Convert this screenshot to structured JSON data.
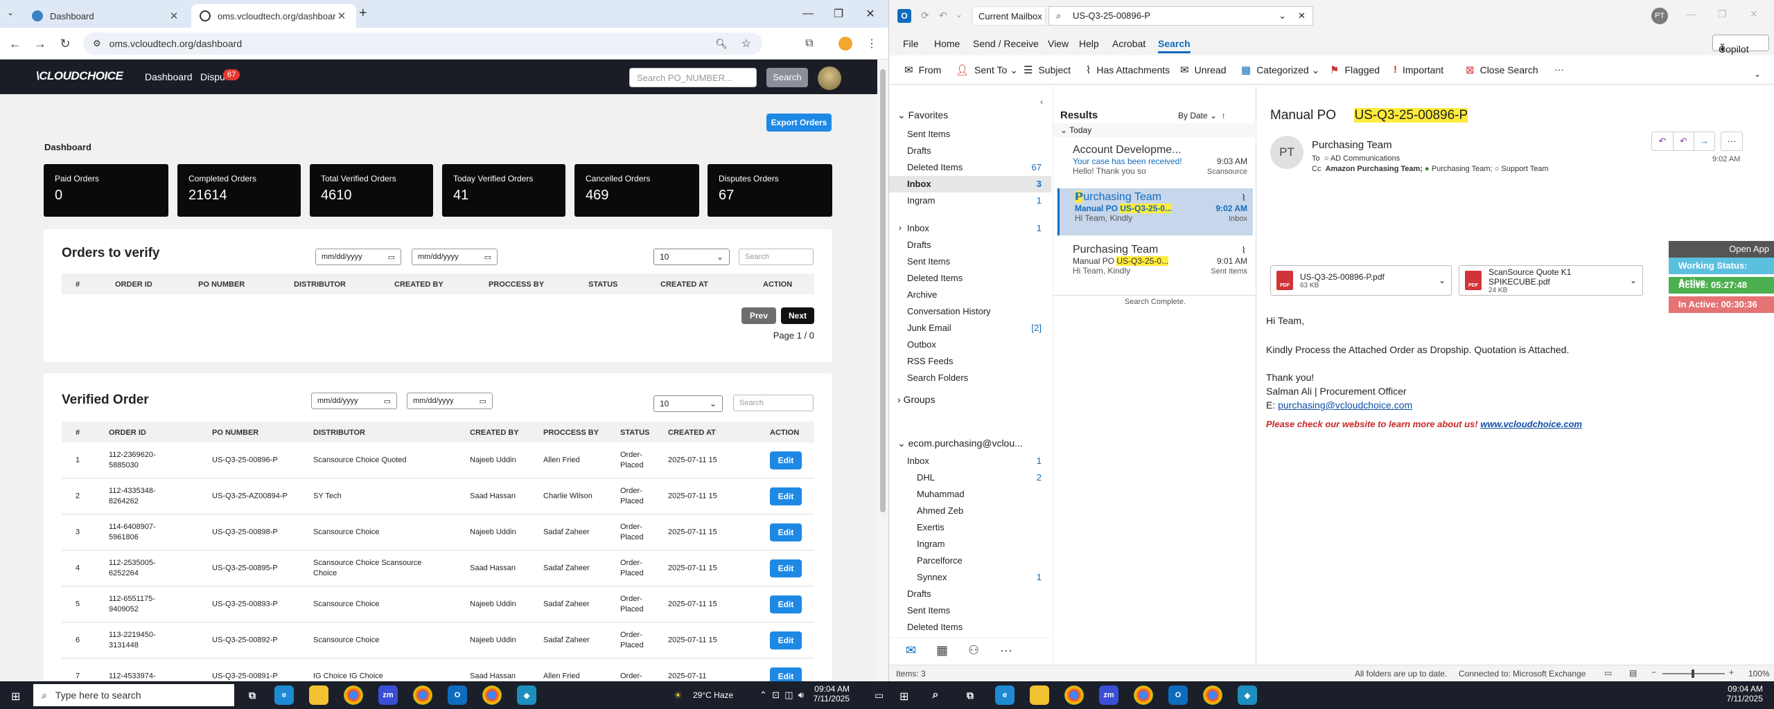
{
  "browser": {
    "tabs": [
      {
        "title": "Dashboard"
      },
      {
        "title": "oms.vcloudtech.org/dashboard"
      }
    ],
    "url": "oms.vcloudtech.org/dashboard"
  },
  "site": {
    "logo": "CLOUDCHOICE",
    "nav": {
      "dashboard": "Dashboard",
      "disputes": "Dispu",
      "disputes_badge": "67"
    },
    "search_placeholder": "Search PO_NUMBER...",
    "search_button": "Search",
    "export_button": "Export Orders",
    "dashboard_title": "Dashboard",
    "cards": [
      {
        "label": "Paid Orders",
        "value": "0"
      },
      {
        "label": "Completed Orders",
        "value": "21614"
      },
      {
        "label": "Total Verified Orders",
        "value": "4610"
      },
      {
        "label": "Today Verified Orders",
        "value": "41"
      },
      {
        "label": "Cancelled Orders",
        "value": "469"
      },
      {
        "label": "Disputes Orders",
        "value": "67"
      }
    ],
    "date_placeholder": "mm/dd/yyyy",
    "page_size": "10",
    "table_search_placeholder": "Search",
    "verify": {
      "title": "Orders to verify",
      "headers": [
        "#",
        "ORDER ID",
        "PO NUMBER",
        "DISTRIBUTOR",
        "CREATED BY",
        "PROCCESS BY",
        "STATUS",
        "CREATED AT",
        "ACTION"
      ],
      "prev": "Prev",
      "next": "Next",
      "page_info": "Page 1 / 0"
    },
    "verified": {
      "title": "Verified Order",
      "headers": [
        "#",
        "ORDER ID",
        "PO NUMBER",
        "DISTRIBUTOR",
        "CREATED BY",
        "PROCCESS BY",
        "STATUS",
        "CREATED AT",
        "ACTION"
      ],
      "edit_label": "Edit",
      "rows": [
        {
          "n": "1",
          "order_id": "112-2369620-5885030",
          "po": "US-Q3-25-00896-P",
          "distributor": "Scansource Choice Quoted",
          "created_by": "Najeeb Uddin",
          "process_by": "Allen Fried",
          "status": "Order-Placed",
          "created_at": "2025-07-11 15"
        },
        {
          "n": "2",
          "order_id": "112-4335348-8264262",
          "po": "US-Q3-25-AZ00894-P",
          "distributor": "SY Tech",
          "created_by": "Saad Hassan",
          "process_by": "Charlie Wilson",
          "status": "Order-Placed",
          "created_at": "2025-07-11 15"
        },
        {
          "n": "3",
          "order_id": "114-6408907-5961806",
          "po": "US-Q3-25-00898-P",
          "distributor": "Scansource Choice",
          "created_by": "Najeeb Uddin",
          "process_by": "Sadaf Zaheer",
          "status": "Order-Placed",
          "created_at": "2025-07-11 15"
        },
        {
          "n": "4",
          "order_id": "112-2535005-6252264",
          "po": "US-Q3-25-00895-P",
          "distributor": "Scansource Choice Scansource Choice",
          "created_by": "Saad Hassan",
          "process_by": "Sadaf Zaheer",
          "status": "Order-Placed",
          "created_at": "2025-07-11 15"
        },
        {
          "n": "5",
          "order_id": "112-6551175-9409052",
          "po": "US-Q3-25-00893-P",
          "distributor": "Scansource Choice",
          "created_by": "Najeeb Uddin",
          "process_by": "Sadaf Zaheer",
          "status": "Order-Placed",
          "created_at": "2025-07-11 15"
        },
        {
          "n": "6",
          "order_id": "113-2219450-3131448",
          "po": "US-Q3-25-00892-P",
          "distributor": "Scansource Choice",
          "created_by": "Najeeb Uddin",
          "process_by": "Sadaf Zaheer",
          "status": "Order-Placed",
          "created_at": "2025-07-11 15"
        },
        {
          "n": "7",
          "order_id": "112-4533974-",
          "po": "US-Q3-25-00891-P",
          "distributor": "IG Choice IG Choice",
          "created_by": "Saad Hassan",
          "process_by": "Allen Fried",
          "status": "Order-",
          "created_at": "2025-07-11"
        }
      ]
    }
  },
  "outlook": {
    "mailbox": "Current Mailbox",
    "search_query": "US-Q3-25-00896-P",
    "user_initials": "PT",
    "copilot": "Copilot",
    "menu": [
      "File",
      "Home",
      "Send / Receive",
      "View",
      "Help",
      "Acrobat",
      "Search"
    ],
    "ribbon": [
      "From",
      "Sent To",
      "Subject",
      "Has Attachments",
      "Unread",
      "Categorized",
      "Flagged",
      "Important",
      "Close Search"
    ],
    "favorites": {
      "title": "Favorites",
      "items": [
        {
          "name": "Sent Items",
          "count": ""
        },
        {
          "name": "Drafts",
          "count": ""
        },
        {
          "name": "Deleted Items",
          "count": "67"
        },
        {
          "name": "Inbox",
          "count": "3"
        },
        {
          "name": "Ingram",
          "count": "1"
        }
      ]
    },
    "mailbox1": {
      "items": [
        {
          "name": "Inbox",
          "count": "1"
        },
        {
          "name": "Drafts",
          "count": ""
        },
        {
          "name": "Sent Items",
          "count": ""
        },
        {
          "name": "Deleted Items",
          "count": ""
        },
        {
          "name": "Archive",
          "count": ""
        },
        {
          "name": "Conversation History",
          "count": ""
        },
        {
          "name": "Junk Email",
          "count": "[2]"
        },
        {
          "name": "Outbox",
          "count": ""
        },
        {
          "name": "RSS Feeds",
          "count": ""
        },
        {
          "name": "Search Folders",
          "count": ""
        }
      ],
      "groups": "Groups"
    },
    "account2": {
      "name": "ecom.purchasing@vclou...",
      "items": [
        {
          "name": "Inbox",
          "count": "1"
        },
        {
          "name": "DHL",
          "count": "2"
        },
        {
          "name": "Muhammad",
          "count": ""
        },
        {
          "name": "Ahmed Zeb",
          "count": ""
        },
        {
          "name": "Exertis",
          "count": ""
        },
        {
          "name": "Ingram",
          "count": ""
        },
        {
          "name": "Parcelforce",
          "count": ""
        },
        {
          "name": "Synnex",
          "count": "1"
        },
        {
          "name": "Drafts",
          "count": ""
        },
        {
          "name": "Sent Items",
          "count": ""
        },
        {
          "name": "Deleted Items",
          "count": ""
        }
      ]
    },
    "results": {
      "title": "Results",
      "sort": "By Date",
      "group": "Today",
      "messages": [
        {
          "from": "Account Developme...",
          "subject": "Your case has been received!",
          "preview": "Hello! Thank you so",
          "time": "9:03 AM",
          "folder": "Scansource"
        },
        {
          "from": "Purchasing Team",
          "subject": "Manual PO",
          "subject_hl": "US-Q3-25-0...",
          "preview": "Hi Team,  Kindly",
          "time": "9:02 AM",
          "folder": "Inbox"
        },
        {
          "from": "Purchasing Team",
          "subject": "Manual PO",
          "subject_hl": "US-Q3-25-0...",
          "preview": "Hi Team,  Kindly",
          "time": "9:01 AM",
          "folder": "Sent Items"
        }
      ],
      "complete": "Search Complete."
    },
    "reading": {
      "subject_prefix": "Manual PO",
      "subject_po": "US-Q3-25-00896-P",
      "avatar": "PT",
      "from": "Purchasing Team",
      "to_label": "To",
      "to": "AD Communications",
      "cc_label": "Cc",
      "cc1": "Amazon Purchasing Team;",
      "cc2": "Purchasing Team;",
      "cc3": "Support Team",
      "time": "9:02 AM",
      "attachments": [
        {
          "name": "US-Q3-25-00896-P.pdf",
          "size": "63 KB"
        },
        {
          "name": "ScanSource Quote K1 SPIKECUBE.pdf",
          "size": "24 KB"
        }
      ],
      "greeting": "Hi Team,",
      "body": "Kindly Process the Attached Order as Dropship. Quotation is Attached.",
      "thanks": "Thank you!",
      "signature": "Salman Ali  | Procurement Officer",
      "email_label": "E: ",
      "email": "purchasing@vcloudchoice.com",
      "footer_text": "Please check our website to learn more about us! ",
      "footer_link": "www.vcloudchoice.com"
    },
    "widget": {
      "open": "Open App",
      "working": "Working Status: Active",
      "active": "Active: 05:27:48",
      "inactive": "In Active: 00:30:36"
    },
    "status": {
      "items": "Items: 3",
      "sync": "All folders are up to date.",
      "conn": "Connected to: Microsoft Exchange",
      "zoom": "100%"
    }
  },
  "taskbar": {
    "search": "Type here to search",
    "weather": "29°C  Haze",
    "time": "09:04 AM",
    "date": "7/11/2025"
  }
}
